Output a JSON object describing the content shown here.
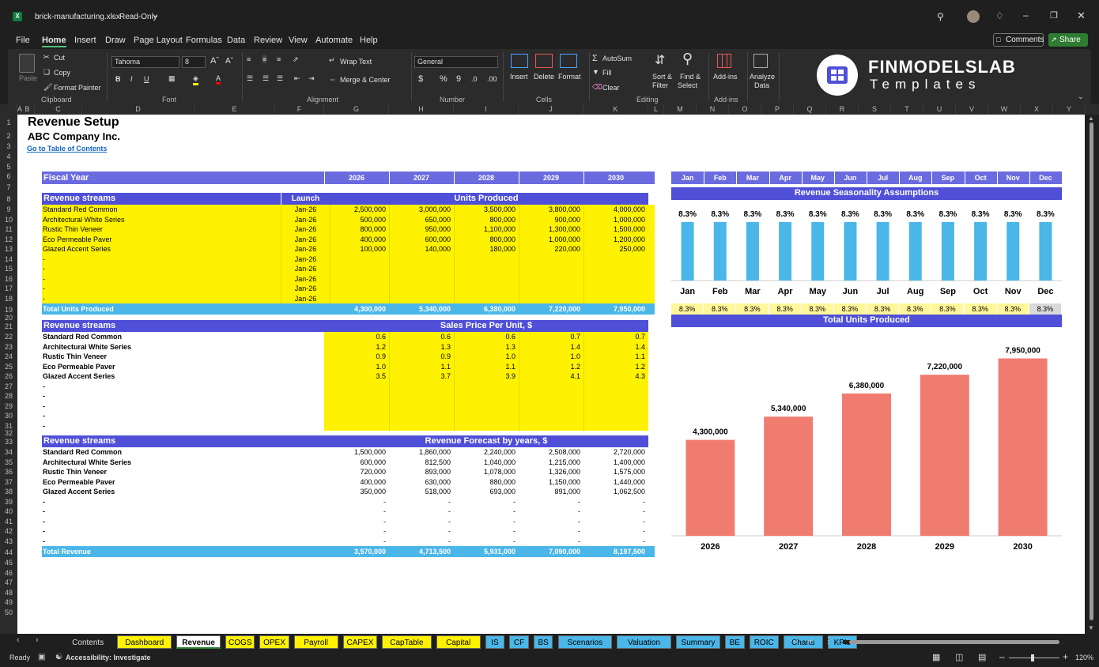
{
  "app": {
    "file_title": "brick-manufacturing.xlsx",
    "read_only": "Read-Only",
    "menus": [
      "File",
      "Home",
      "Insert",
      "Draw",
      "Page Layout",
      "Formulas",
      "Data",
      "Review",
      "View",
      "Automate",
      "Help"
    ],
    "comments_label": "Comments",
    "share_label": "Share"
  },
  "ribbon": {
    "clipboard": {
      "paste": "Paste",
      "cut": "Cut",
      "copy": "Copy",
      "format_painter": "Format Painter",
      "group": "Clipboard"
    },
    "font": {
      "name": "Tahoma",
      "size": "8",
      "group": "Font"
    },
    "alignment": {
      "wrap": "Wrap Text",
      "merge": "Merge & Center",
      "group": "Alignment"
    },
    "number": {
      "format": "General",
      "group": "Number"
    },
    "cells": {
      "insert": "Insert",
      "delete": "Delete",
      "format": "Format",
      "group": "Cells"
    },
    "editing": {
      "autosum": "AutoSum",
      "fill": "Fill",
      "clear": "Clear",
      "sort": "Sort &",
      "sort2": "Filter",
      "find": "Find &",
      "find2": "Select",
      "group": "Editing"
    },
    "addins": {
      "addins": "Add-ins",
      "group": "Add-ins",
      "analyze": "Analyze",
      "analyze2": "Data"
    },
    "brand": {
      "name": "FINMODELSLAB",
      "sub": "Templates"
    }
  },
  "columns": [
    "A",
    "B",
    "C",
    "D",
    "E",
    "F",
    "G",
    "H",
    "I",
    "J",
    "K",
    "L",
    "M",
    "N",
    "O",
    "P",
    "Q",
    "R",
    "S",
    "T",
    "U",
    "V",
    "W",
    "X",
    "Y"
  ],
  "sheet": {
    "title": "Revenue Setup",
    "company": "ABC Company Inc.",
    "toc_link": "Go to Table of Contents",
    "fiscal_year": "Fiscal Year",
    "years": [
      "2026",
      "2027",
      "2028",
      "2029",
      "2030"
    ],
    "months": [
      "Jan",
      "Feb",
      "Mar",
      "Apr",
      "May",
      "Jun",
      "Jul",
      "Aug",
      "Sep",
      "Oct",
      "Nov",
      "Dec"
    ],
    "units": {
      "header": "Revenue streams",
      "launch_header": "Launch",
      "block_title": "Units Produced",
      "rows": [
        {
          "name": "Standard Red Common",
          "launch": "Jan-26",
          "values": [
            "2,500,000",
            "3,000,000",
            "3,500,000",
            "3,800,000",
            "4,000,000"
          ]
        },
        {
          "name": "Architectural White Series",
          "launch": "Jan-26",
          "values": [
            "500,000",
            "650,000",
            "800,000",
            "900,000",
            "1,000,000"
          ]
        },
        {
          "name": "Rustic Thin Veneer",
          "launch": "Jan-26",
          "values": [
            "800,000",
            "950,000",
            "1,100,000",
            "1,300,000",
            "1,500,000"
          ]
        },
        {
          "name": "Eco Permeable Paver",
          "launch": "Jan-26",
          "values": [
            "400,000",
            "600,000",
            "800,000",
            "1,000,000",
            "1,200,000"
          ]
        },
        {
          "name": "Glazed Accent Series",
          "launch": "Jan-26",
          "values": [
            "100,000",
            "140,000",
            "180,000",
            "220,000",
            "250,000"
          ]
        },
        {
          "name": "-",
          "launch": "Jan-26",
          "values": [
            "",
            "",
            "",
            "",
            ""
          ]
        },
        {
          "name": "-",
          "launch": "Jan-26",
          "values": [
            "",
            "",
            "",
            "",
            ""
          ]
        },
        {
          "name": "-",
          "launch": "Jan-26",
          "values": [
            "",
            "",
            "",
            "",
            ""
          ]
        },
        {
          "name": "-",
          "launch": "Jan-26",
          "values": [
            "",
            "",
            "",
            "",
            ""
          ]
        },
        {
          "name": "-",
          "launch": "Jan-26",
          "values": [
            "",
            "",
            "",
            "",
            ""
          ]
        }
      ],
      "total_label": "Total Units Produced",
      "totals": [
        "4,300,000",
        "5,340,000",
        "6,380,000",
        "7,220,000",
        "7,950,000"
      ]
    },
    "price": {
      "header": "Revenue streams",
      "block_title": "Sales Price Per Unit, $",
      "rows": [
        {
          "name": "Standard Red Common",
          "values": [
            "0.6",
            "0.6",
            "0.6",
            "0.7",
            "0.7"
          ]
        },
        {
          "name": "Architectural White Series",
          "values": [
            "1.2",
            "1.3",
            "1.3",
            "1.4",
            "1.4"
          ]
        },
        {
          "name": "Rustic Thin Veneer",
          "values": [
            "0.9",
            "0.9",
            "1.0",
            "1.0",
            "1.1"
          ]
        },
        {
          "name": "Eco Permeable Paver",
          "values": [
            "1.0",
            "1.1",
            "1.1",
            "1.2",
            "1.2"
          ]
        },
        {
          "name": "Glazed Accent Series",
          "values": [
            "3.5",
            "3.7",
            "3.9",
            "4.1",
            "4.3"
          ]
        },
        {
          "name": "-",
          "values": [
            "",
            "",
            "",
            "",
            ""
          ]
        },
        {
          "name": "-",
          "values": [
            "",
            "",
            "",
            "",
            ""
          ]
        },
        {
          "name": "-",
          "values": [
            "",
            "",
            "",
            "",
            ""
          ]
        },
        {
          "name": "-",
          "values": [
            "",
            "",
            "",
            "",
            ""
          ]
        },
        {
          "name": "-",
          "values": [
            "",
            "",
            "",
            "",
            ""
          ]
        }
      ]
    },
    "revenue": {
      "header": "Revenue streams",
      "block_title": "Revenue Forecast by years, $",
      "rows": [
        {
          "name": "Standard Red Common",
          "values": [
            "1,500,000",
            "1,860,000",
            "2,240,000",
            "2,508,000",
            "2,720,000"
          ]
        },
        {
          "name": "Architectural White Series",
          "values": [
            "600,000",
            "812,500",
            "1,040,000",
            "1,215,000",
            "1,400,000"
          ]
        },
        {
          "name": "Rustic Thin Veneer",
          "values": [
            "720,000",
            "893,000",
            "1,078,000",
            "1,326,000",
            "1,575,000"
          ]
        },
        {
          "name": "Eco Permeable Paver",
          "values": [
            "400,000",
            "630,000",
            "880,000",
            "1,150,000",
            "1,440,000"
          ]
        },
        {
          "name": "Glazed Accent Series",
          "values": [
            "350,000",
            "518,000",
            "693,000",
            "891,000",
            "1,062,500"
          ]
        },
        {
          "name": "-",
          "values": [
            "-",
            "-",
            "-",
            "-",
            "-"
          ]
        },
        {
          "name": "-",
          "values": [
            "-",
            "-",
            "-",
            "-",
            "-"
          ]
        },
        {
          "name": "-",
          "values": [
            "-",
            "-",
            "-",
            "-",
            "-"
          ]
        },
        {
          "name": "-",
          "values": [
            "-",
            "-",
            "-",
            "-",
            "-"
          ]
        },
        {
          "name": "-",
          "values": [
            "-",
            "-",
            "-",
            "-",
            "-"
          ]
        }
      ],
      "total_label": "Total Revenue",
      "totals": [
        "3,570,000",
        "4,713,500",
        "5,931,000",
        "7,090,000",
        "8,197,500"
      ]
    },
    "seasonality_title": "Revenue Seasonality Assumptions",
    "seasonality_values": [
      "8.3%",
      "8.3%",
      "8.3%",
      "8.3%",
      "8.3%",
      "8.3%",
      "8.3%",
      "8.3%",
      "8.3%",
      "8.3%",
      "8.3%",
      "8.3%"
    ],
    "units_chart_title": "Total Units Produced"
  },
  "chart_data": [
    {
      "type": "bar",
      "title": "Revenue Seasonality Assumptions",
      "categories": [
        "Jan",
        "Feb",
        "Mar",
        "Apr",
        "May",
        "Jun",
        "Jul",
        "Aug",
        "Sep",
        "Oct",
        "Nov",
        "Dec"
      ],
      "values": [
        8.3,
        8.3,
        8.3,
        8.3,
        8.3,
        8.3,
        8.3,
        8.3,
        8.3,
        8.3,
        8.3,
        8.3
      ],
      "data_labels": [
        "8.3%",
        "8.3%",
        "8.3%",
        "8.3%",
        "8.3%",
        "8.3%",
        "8.3%",
        "8.3%",
        "8.3%",
        "8.3%",
        "8.3%",
        "8.3%"
      ],
      "color": "#4bb6e8"
    },
    {
      "type": "bar",
      "title": "Total Units Produced",
      "categories": [
        "2026",
        "2027",
        "2028",
        "2029",
        "2030"
      ],
      "values": [
        4300000,
        5340000,
        6380000,
        7220000,
        7950000
      ],
      "data_labels": [
        "4,300,000",
        "5,340,000",
        "6,380,000",
        "7,220,000",
        "7,950,000"
      ],
      "ylim": [
        0,
        8500000
      ],
      "color": "#f07c70"
    }
  ],
  "tabs": [
    "Contents",
    "Dashboard",
    "Revenue",
    "COGS",
    "OPEX",
    "Payroll",
    "CAPEX",
    "CapTable",
    "Capital",
    "IS",
    "CF",
    "BS",
    "Scenarios",
    "Valuation",
    "Summary",
    "BE",
    "ROIC",
    "Charts",
    "KPIs"
  ],
  "active_tab": "Revenue",
  "status": {
    "ready": "Ready",
    "accessibility": "Accessibility: Investigate",
    "zoom": "120%"
  }
}
